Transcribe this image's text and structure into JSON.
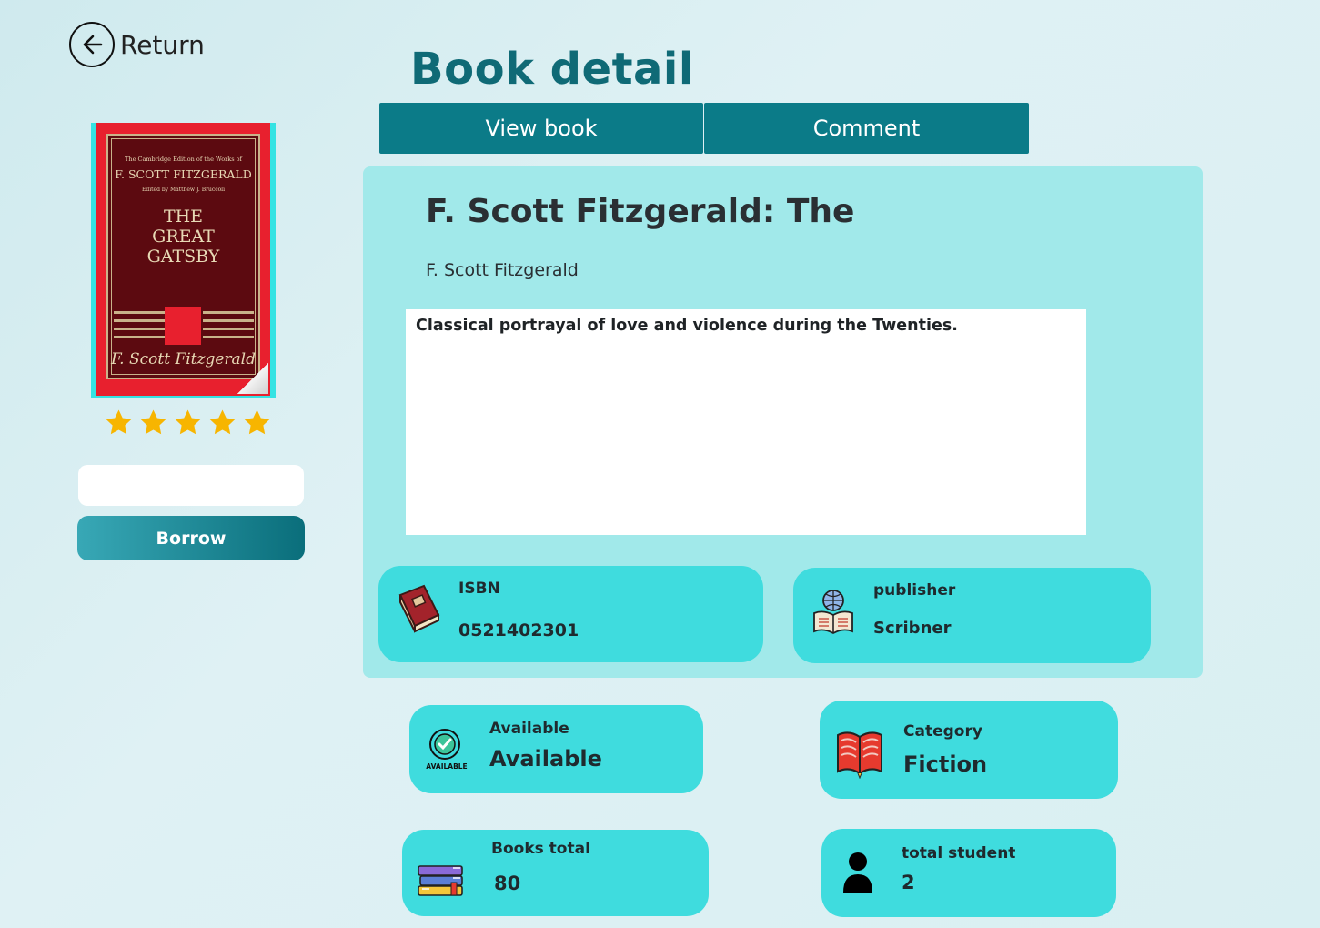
{
  "header": {
    "return_label": "Return",
    "page_title": "Book detail"
  },
  "tabs": [
    {
      "label": "View book"
    },
    {
      "label": "Comment"
    }
  ],
  "cover": {
    "series_line": "The Cambridge Edition of the Works of",
    "author_line": "F. SCOTT FITZGERALD",
    "editor_line": "Edited by Matthew J. Bruccoli",
    "title_line1": "THE",
    "title_line2": "GREAT",
    "title_line3": "GATSBY",
    "signature": "F. Scott Fitzgerald"
  },
  "rating": {
    "stars": 5,
    "max": 5,
    "color": "#f7b500"
  },
  "borrow": {
    "input_value": "",
    "button_label": "Borrow"
  },
  "book": {
    "title": "F. Scott Fitzgerald: The",
    "author": "F. Scott Fitzgerald",
    "description": "Classical portrayal of love and violence during the Twenties."
  },
  "info": {
    "isbn": {
      "label": "ISBN",
      "value": "0521402301",
      "icon": "book-icon"
    },
    "publisher": {
      "label": "publisher",
      "value": "Scribner",
      "icon": "open-book-globe-icon"
    },
    "available": {
      "label": "Available",
      "value": "Available",
      "icon": "available-badge-icon",
      "icon_text": "AVAILABLE"
    },
    "category": {
      "label": "Category",
      "value": "Fiction",
      "icon": "red-book-icon"
    },
    "books_total": {
      "label": "Books total",
      "value": "80",
      "icon": "book-stack-icon"
    },
    "total_student": {
      "label": "total student",
      "value": "2",
      "icon": "person-icon"
    }
  },
  "colors": {
    "accent": "#0b7b88",
    "title": "#0f6a76",
    "panel": "#a1e9ea",
    "card": "#3fdcde"
  }
}
